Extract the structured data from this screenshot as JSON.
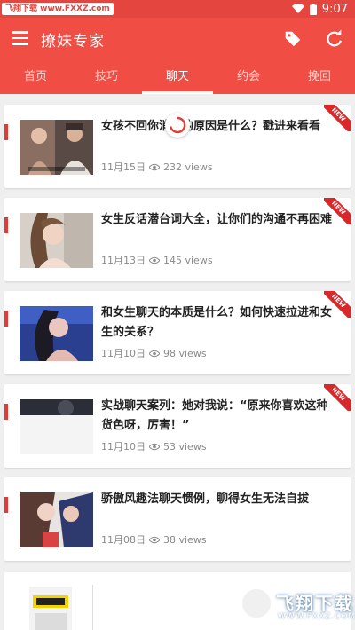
{
  "status_bar": {
    "watermark": "飞翔下载 www.FXXZ.com",
    "time": "9:07"
  },
  "app_bar": {
    "title": "撩妹专家"
  },
  "tabs": [
    {
      "label": "首页"
    },
    {
      "label": "技巧"
    },
    {
      "label": "聊天",
      "active": true
    },
    {
      "label": "约会"
    },
    {
      "label": "挽回"
    }
  ],
  "articles": [
    {
      "title": "女孩不回你消息的原因是什么？戳进来看看",
      "date": "11月15日",
      "views": "232 views",
      "badge": "NEW"
    },
    {
      "title": "女生反话潜台词大全，让你们的沟通不再困难",
      "date": "11月13日",
      "views": "145 views",
      "badge": "NEW"
    },
    {
      "title": "和女生聊天的本质是什么？如何快速拉进和女生的关系？",
      "date": "11月10日",
      "views": "98 views",
      "badge": "NEW"
    },
    {
      "title": "实战聊天案列：她对我说：“原来你喜欢这种货色呀，厉害！”",
      "date": "11月10日",
      "views": "53 views",
      "badge": "NEW"
    },
    {
      "title": "骄傲风趣法聊天惯例，聊得女生无法自拔",
      "date": "11月08日",
      "views": "38 views"
    }
  ],
  "watermark_logo": {
    "text": "飞翔下载",
    "url_text": "WWW.FXXZ.COM"
  },
  "colors": {
    "primary": "#f04d45",
    "status_bar": "#e4463f",
    "badge": "#d9272a",
    "accent_mark": "#e43a36"
  }
}
